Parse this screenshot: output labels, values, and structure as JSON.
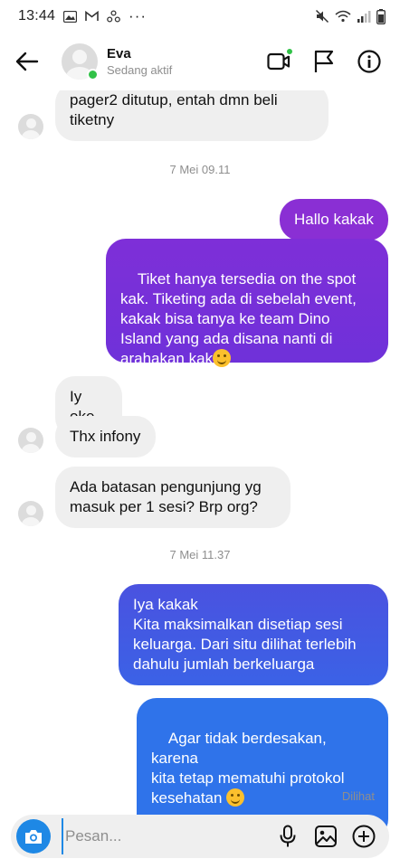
{
  "status_bar": {
    "time": "13:44",
    "more": "···"
  },
  "header": {
    "name": "Eva",
    "status": "Sedang aktif"
  },
  "messages": {
    "m1": "pager2 ditutup, entah dmn beli\ntiketny",
    "ts1": "7 Mei 09.11",
    "m2": "Hallo kakak",
    "m3": "Tiket hanya tersedia on the spot\nkak. Tiketing ada di sebelah event,\nkakak bisa tanya ke team Dino\nIsland yang ada disana nanti di\narahakan kak",
    "m4": "Iy oke",
    "m5": "Thx infony",
    "m6": "Ada batasan pengunjung yg\nmasuk per 1 sesi? Brp org?",
    "ts2": "7 Mei 11.37",
    "m7": "Iya kakak\nKita maksimalkan disetiap sesi\nkeluarga. Dari situ dilihat terlebih\ndahulu jumlah berkeluarga",
    "m8": "Agar tidak berdesakan, karena\nkita tetap mematuhi protokol\nkesehatan",
    "seen": "Dilihat"
  },
  "composer": {
    "placeholder": "Pesan..."
  },
  "colors": {
    "purple": "#7b2fd6",
    "violet": "#5b3fdc",
    "blue": "#2f6fea",
    "incoming": "#efefef",
    "online": "#31c248"
  },
  "icons": [
    "back-arrow-icon",
    "video-call-icon",
    "flag-icon",
    "info-icon",
    "camera-icon",
    "microphone-icon",
    "gallery-icon",
    "plus-icon",
    "smiling-face-emoji"
  ]
}
